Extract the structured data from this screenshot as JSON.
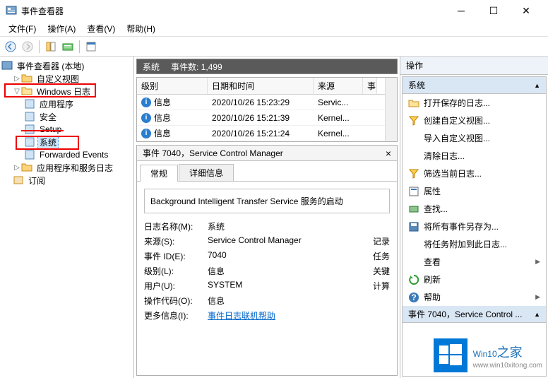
{
  "title": "事件查看器",
  "menu": {
    "file": "文件(F)",
    "action": "操作(A)",
    "view": "查看(V)",
    "help": "帮助(H)"
  },
  "tree": {
    "root": "事件查看器 (本地)",
    "custom_views": "自定义视图",
    "windows_logs": "Windows 日志",
    "application": "应用程序",
    "security": "安全",
    "setup": "Setup",
    "system": "系统",
    "forwarded": "Forwarded Events",
    "app_service_logs": "应用程序和服务日志",
    "subscription": "订阅"
  },
  "grid_header": {
    "level": "级别",
    "datetime": "日期和时间",
    "source": "来源",
    "event": "事"
  },
  "grid_summary": {
    "section": "系统",
    "count_label": "事件数: 1,499"
  },
  "rows": [
    {
      "level": "信息",
      "datetime": "2020/10/26 15:23:29",
      "source": "Servic..."
    },
    {
      "level": "信息",
      "datetime": "2020/10/26 15:21:39",
      "source": "Kernel..."
    },
    {
      "level": "信息",
      "datetime": "2020/10/26 15:21:24",
      "source": "Kernel..."
    }
  ],
  "detail": {
    "title": "事件 7040，Service Control Manager",
    "tabs": {
      "general": "常规",
      "details": "详细信息"
    },
    "description": "Background Intelligent Transfer Service 服务的启动",
    "log_name_l": "日志名称(M):",
    "log_name_v": "系统",
    "source_l": "来源(S):",
    "source_v": "Service Control Manager",
    "source_r": "记录",
    "eventid_l": "事件 ID(E):",
    "eventid_v": "7040",
    "eventid_r": "任务",
    "level_l": "级别(L):",
    "level_v": "信息",
    "level_r": "关键",
    "user_l": "用户(U):",
    "user_v": "SYSTEM",
    "user_r": "计算",
    "opcode_l": "操作代码(O):",
    "opcode_v": "信息",
    "more_l": "更多信息(I):",
    "more_link": "事件日志联机帮助"
  },
  "actions": {
    "header": "操作",
    "section1": "系统",
    "open_saved": "打开保存的日志...",
    "create_view": "创建自定义视图...",
    "import_view": "导入自定义视图...",
    "clear_log": "清除日志...",
    "filter": "筛选当前日志...",
    "properties": "属性",
    "find": "查找...",
    "save_all": "将所有事件另存为...",
    "attach_task": "将任务附加到此日志...",
    "view": "查看",
    "refresh": "刷新",
    "help": "帮助",
    "section2": "事件 7040，Service Control ..."
  },
  "watermark": {
    "brand": "Win10",
    "suffix": "之家",
    "url": "www.win10xitong.com"
  }
}
